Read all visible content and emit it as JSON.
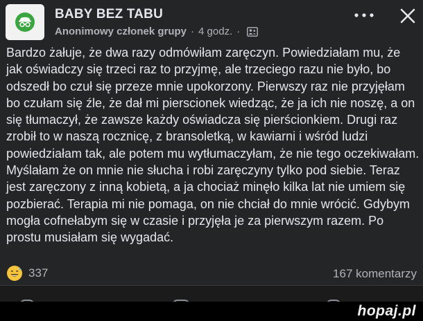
{
  "post": {
    "group_name": "BABY BEZ TABU",
    "author": "Anonimowy członek grupy",
    "separator": "·",
    "time": "4 godz.",
    "more_icon": "more-horizontal-icon",
    "close_icon": "close-icon",
    "avatar_icon": "anonymous-incognito-icon",
    "privacy_icon": "group-members-icon",
    "text": "Bardzo żałuje, że dwa razy odmówiłam zaręczyn. Powiedziałam mu, że jak oświadczy się trzeci raz to przyjmę, ale trzeciego razu nie było, bo odszedł bo czuł się przeze mnie upokorzony. Pierwszy raz nie przyjęłam bo czułam się źle, że dał mi pierscionek wiedząc, że ja ich nie noszę, a on się tłumaczył, że zawsze każdy oświadcza się pierścionkiem. Drugi raz zrobił to w naszą rocznicę, z bransoletką, w kawiarni i wśród ludzi powiedziałam tak, ale potem mu wytłumaczyłam, że nie tego oczekiwałam. Myślałam że on mnie nie słucha i robi zaręczyny tylko pod siebie. Teraz jest zaręczony z inną kobietą, a ja chociaż minęło kilka lat nie umiem się pozbierać. Terapia mi nie pomaga, on nie chciał do mnie wrócić. Gdybym mogła cofnełabym się w czasie i przyjęła je za pierwszym razem. Po prostu musiałam się wygadać.",
    "reaction_icon": "grinning-sweat-emoji-icon",
    "reaction_count": "337",
    "comments": "167 komentarzy"
  },
  "watermark": "hopaj.pl",
  "colors": {
    "background": "#242526",
    "text": "#e4e6eb",
    "secondary_text": "#b0b3b8",
    "avatar_green": "#3aa640"
  }
}
